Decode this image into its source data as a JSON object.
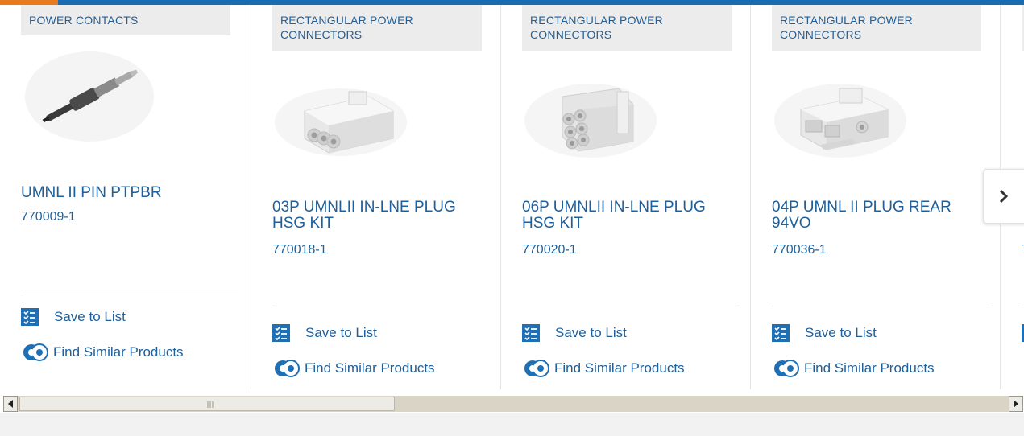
{
  "products": [
    {
      "category": "POWER CONTACTS",
      "image_icon": "pin-contact-image",
      "title": "UMNL II PIN PTPBR",
      "part_number": "770009-1",
      "save_label": "Save to List",
      "similar_label": "Find Similar Products"
    },
    {
      "category": "RECTANGULAR POWER CONNECTORS",
      "image_icon": "3-position-plug-housing-image",
      "title": "03P UMNLII IN-LNE PLUG HSG KIT",
      "part_number": "770018-1",
      "save_label": "Save to List",
      "similar_label": "Find Similar Products"
    },
    {
      "category": "RECTANGULAR POWER CONNECTORS",
      "image_icon": "6-position-plug-housing-image",
      "title": "06P UMNLII IN-LNE PLUG HSG KIT",
      "part_number": "770020-1",
      "save_label": "Save to List",
      "similar_label": "Find Similar Products"
    },
    {
      "category": "RECTANGULAR POWER CONNECTORS",
      "image_icon": "4-position-plug-housing-image",
      "title": "04P UMNL II PLUG REAR 94VO",
      "part_number": "770036-1",
      "save_label": "Save to List",
      "similar_label": "Find Similar Products"
    },
    {
      "category": "",
      "title": "",
      "part_number": "7",
      "save_label": "",
      "similar_label": ""
    }
  ],
  "carousel": {
    "next_icon": "chevron-right-icon"
  },
  "scrollbar": {
    "left_arrow": "◀",
    "right_arrow": "▶"
  },
  "colors": {
    "brand_blue": "#1f5f9a",
    "top_bar": "#1c6bb0",
    "top_accent": "#e8791c",
    "category_bg": "#ececec"
  }
}
